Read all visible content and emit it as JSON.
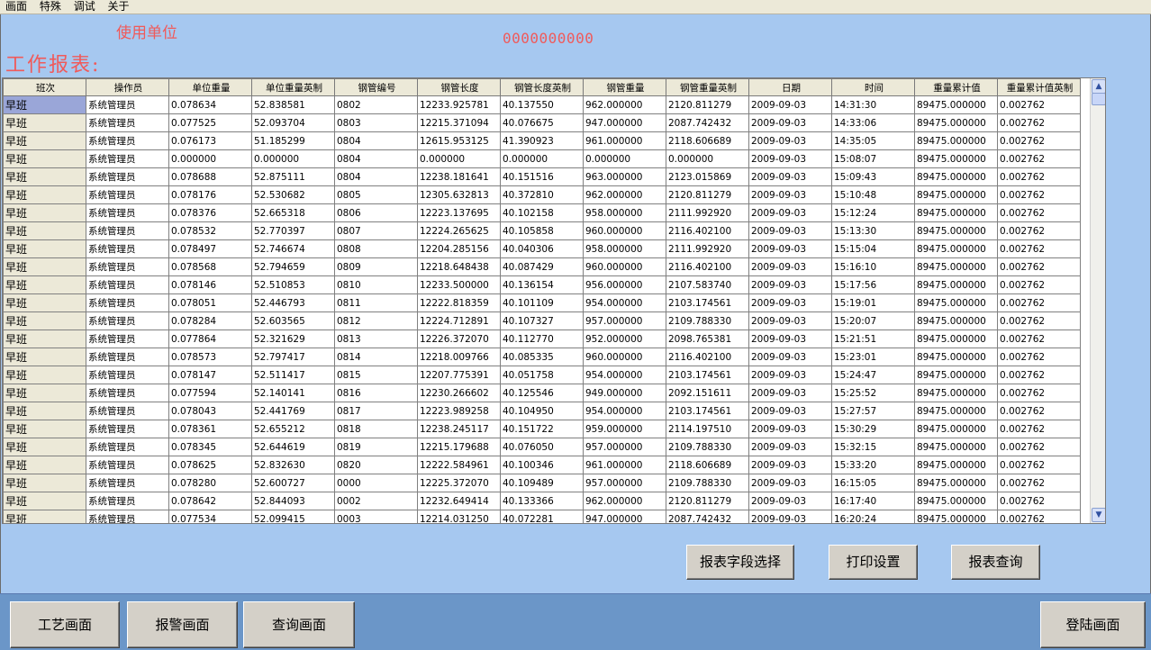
{
  "menu": [
    "画面",
    "特殊",
    "调试",
    "关于"
  ],
  "org_label": "使用单位",
  "serial": "0000000000",
  "report_title": "工作报表:",
  "table": {
    "columns": [
      "班次",
      "操作员",
      "单位重量",
      "单位重量英制",
      "钢管编号",
      "钢管长度",
      "钢管长度英制",
      "钢管重量",
      "钢管重量英制",
      "日期",
      "时间",
      "重量累计值",
      "重量累计值英制"
    ],
    "rows": [
      [
        "早班",
        "系统管理员",
        "0.078634",
        "52.838581",
        "0802",
        "12233.925781",
        "40.137550",
        "962.000000",
        "2120.811279",
        "2009-09-03",
        "14:31:30",
        "89475.000000",
        "0.002762"
      ],
      [
        "早班",
        "系统管理员",
        "0.077525",
        "52.093704",
        "0803",
        "12215.371094",
        "40.076675",
        "947.000000",
        "2087.742432",
        "2009-09-03",
        "14:33:06",
        "89475.000000",
        "0.002762"
      ],
      [
        "早班",
        "系统管理员",
        "0.076173",
        "51.185299",
        "0804",
        "12615.953125",
        "41.390923",
        "961.000000",
        "2118.606689",
        "2009-09-03",
        "14:35:05",
        "89475.000000",
        "0.002762"
      ],
      [
        "早班",
        "系统管理员",
        "0.000000",
        "0.000000",
        "0804",
        "0.000000",
        "0.000000",
        "0.000000",
        "0.000000",
        "2009-09-03",
        "15:08:07",
        "89475.000000",
        "0.002762"
      ],
      [
        "早班",
        "系统管理员",
        "0.078688",
        "52.875111",
        "0804",
        "12238.181641",
        "40.151516",
        "963.000000",
        "2123.015869",
        "2009-09-03",
        "15:09:43",
        "89475.000000",
        "0.002762"
      ],
      [
        "早班",
        "系统管理员",
        "0.078176",
        "52.530682",
        "0805",
        "12305.632813",
        "40.372810",
        "962.000000",
        "2120.811279",
        "2009-09-03",
        "15:10:48",
        "89475.000000",
        "0.002762"
      ],
      [
        "早班",
        "系统管理员",
        "0.078376",
        "52.665318",
        "0806",
        "12223.137695",
        "40.102158",
        "958.000000",
        "2111.992920",
        "2009-09-03",
        "15:12:24",
        "89475.000000",
        "0.002762"
      ],
      [
        "早班",
        "系统管理员",
        "0.078532",
        "52.770397",
        "0807",
        "12224.265625",
        "40.105858",
        "960.000000",
        "2116.402100",
        "2009-09-03",
        "15:13:30",
        "89475.000000",
        "0.002762"
      ],
      [
        "早班",
        "系统管理员",
        "0.078497",
        "52.746674",
        "0808",
        "12204.285156",
        "40.040306",
        "958.000000",
        "2111.992920",
        "2009-09-03",
        "15:15:04",
        "89475.000000",
        "0.002762"
      ],
      [
        "早班",
        "系统管理员",
        "0.078568",
        "52.794659",
        "0809",
        "12218.648438",
        "40.087429",
        "960.000000",
        "2116.402100",
        "2009-09-03",
        "15:16:10",
        "89475.000000",
        "0.002762"
      ],
      [
        "早班",
        "系统管理员",
        "0.078146",
        "52.510853",
        "0810",
        "12233.500000",
        "40.136154",
        "956.000000",
        "2107.583740",
        "2009-09-03",
        "15:17:56",
        "89475.000000",
        "0.002762"
      ],
      [
        "早班",
        "系统管理员",
        "0.078051",
        "52.446793",
        "0811",
        "12222.818359",
        "40.101109",
        "954.000000",
        "2103.174561",
        "2009-09-03",
        "15:19:01",
        "89475.000000",
        "0.002762"
      ],
      [
        "早班",
        "系统管理员",
        "0.078284",
        "52.603565",
        "0812",
        "12224.712891",
        "40.107327",
        "957.000000",
        "2109.788330",
        "2009-09-03",
        "15:20:07",
        "89475.000000",
        "0.002762"
      ],
      [
        "早班",
        "系统管理员",
        "0.077864",
        "52.321629",
        "0813",
        "12226.372070",
        "40.112770",
        "952.000000",
        "2098.765381",
        "2009-09-03",
        "15:21:51",
        "89475.000000",
        "0.002762"
      ],
      [
        "早班",
        "系统管理员",
        "0.078573",
        "52.797417",
        "0814",
        "12218.009766",
        "40.085335",
        "960.000000",
        "2116.402100",
        "2009-09-03",
        "15:23:01",
        "89475.000000",
        "0.002762"
      ],
      [
        "早班",
        "系统管理员",
        "0.078147",
        "52.511417",
        "0815",
        "12207.775391",
        "40.051758",
        "954.000000",
        "2103.174561",
        "2009-09-03",
        "15:24:47",
        "89475.000000",
        "0.002762"
      ],
      [
        "早班",
        "系统管理员",
        "0.077594",
        "52.140141",
        "0816",
        "12230.266602",
        "40.125546",
        "949.000000",
        "2092.151611",
        "2009-09-03",
        "15:25:52",
        "89475.000000",
        "0.002762"
      ],
      [
        "早班",
        "系统管理员",
        "0.078043",
        "52.441769",
        "0817",
        "12223.989258",
        "40.104950",
        "954.000000",
        "2103.174561",
        "2009-09-03",
        "15:27:57",
        "89475.000000",
        "0.002762"
      ],
      [
        "早班",
        "系统管理员",
        "0.078361",
        "52.655212",
        "0818",
        "12238.245117",
        "40.151722",
        "959.000000",
        "2114.197510",
        "2009-09-03",
        "15:30:29",
        "89475.000000",
        "0.002762"
      ],
      [
        "早班",
        "系统管理员",
        "0.078345",
        "52.644619",
        "0819",
        "12215.179688",
        "40.076050",
        "957.000000",
        "2109.788330",
        "2009-09-03",
        "15:32:15",
        "89475.000000",
        "0.002762"
      ],
      [
        "早班",
        "系统管理员",
        "0.078625",
        "52.832630",
        "0820",
        "12222.584961",
        "40.100346",
        "961.000000",
        "2118.606689",
        "2009-09-03",
        "15:33:20",
        "89475.000000",
        "0.002762"
      ],
      [
        "早班",
        "系统管理员",
        "0.078280",
        "52.600727",
        "0000",
        "12225.372070",
        "40.109489",
        "957.000000",
        "2109.788330",
        "2009-09-03",
        "16:15:05",
        "89475.000000",
        "0.002762"
      ],
      [
        "早班",
        "系统管理员",
        "0.078642",
        "52.844093",
        "0002",
        "12232.649414",
        "40.133366",
        "962.000000",
        "2120.811279",
        "2009-09-03",
        "16:17:40",
        "89475.000000",
        "0.002762"
      ],
      [
        "早班",
        "系统管理员",
        "0.077534",
        "52.099415",
        "0003",
        "12214.031250",
        "40.072281",
        "947.000000",
        "2087.742432",
        "2009-09-03",
        "16:20:24",
        "89475.000000",
        "0.002762"
      ]
    ]
  },
  "scrollbar": {
    "up_icon": "▲",
    "down_icon": "▼"
  },
  "actions": {
    "field_select": "报表字段选择",
    "print_setup": "打印设置",
    "report_query": "报表查询"
  },
  "nav": {
    "process": "工艺画面",
    "alarm": "报警画面",
    "query": "查询画面",
    "login": "登陆画面"
  }
}
